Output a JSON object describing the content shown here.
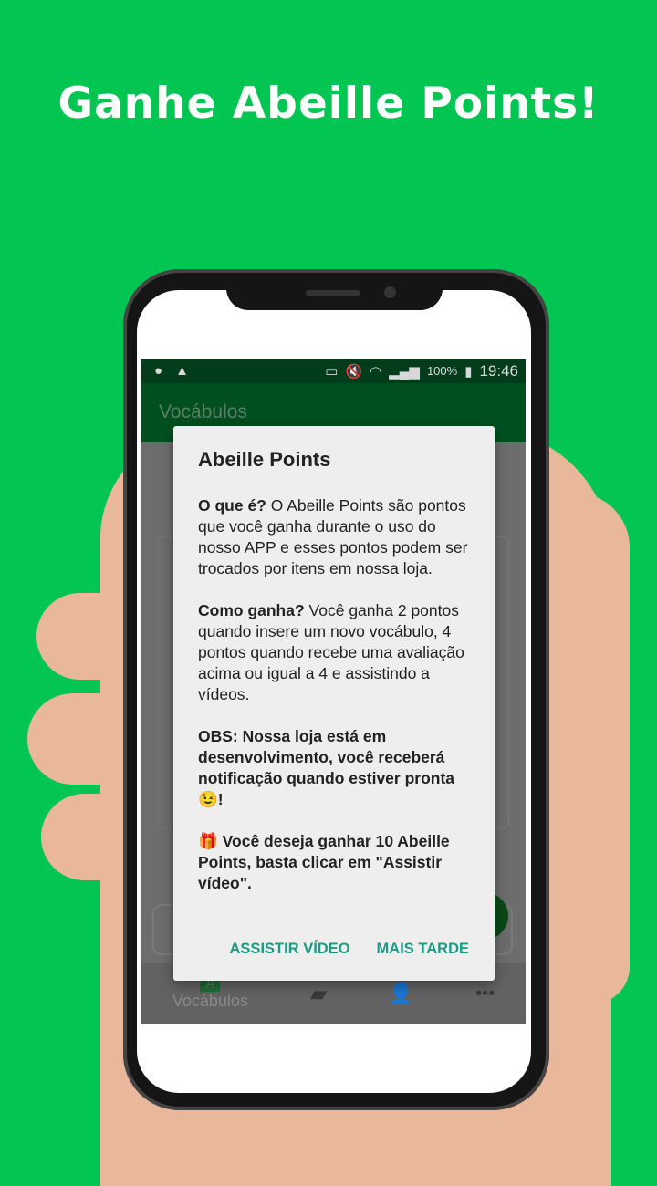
{
  "headline": "Ganhe Abeille Points!",
  "status_bar": {
    "battery": "100%",
    "time": "19:46"
  },
  "app_bar": {
    "title": "Vocábulos"
  },
  "bottom_nav": {
    "items": [
      {
        "label": "Vocábulos",
        "icon": "A"
      },
      {
        "icon": "chat-icon"
      },
      {
        "icon": "person-icon"
      },
      {
        "icon": "more-icon"
      }
    ]
  },
  "dialog": {
    "title": "Abeille Points",
    "p1_label": "O que é?",
    "p1_text": " O Abeille Points são pontos que você ganha durante o uso do nosso APP e esses pontos podem ser trocados por itens em nossa loja.",
    "p2_label": "Como ganha?",
    "p2_text": " Você ganha 2 pontos quando insere um novo vocábulo, 4 pontos quando recebe uma avaliação acima ou igual a 4 e assistindo a vídeos.",
    "p3_text": "OBS: Nossa loja está em desenvolvimento, você receberá notificação quando estiver pronta",
    "p3_emoji": "😉",
    "p3_end": "!",
    "p4_emoji": "🎁",
    "p4_text": " Você deseja ganhar 10 Abeille Points, basta clicar em \"Assistir vídeo\".",
    "watch_button": "ASSISTIR VÍDEO",
    "later_button": "MAIS TARDE"
  },
  "colors": {
    "background": "#02c552",
    "accent": "#1b9c85",
    "app_bar": "#00501f"
  }
}
